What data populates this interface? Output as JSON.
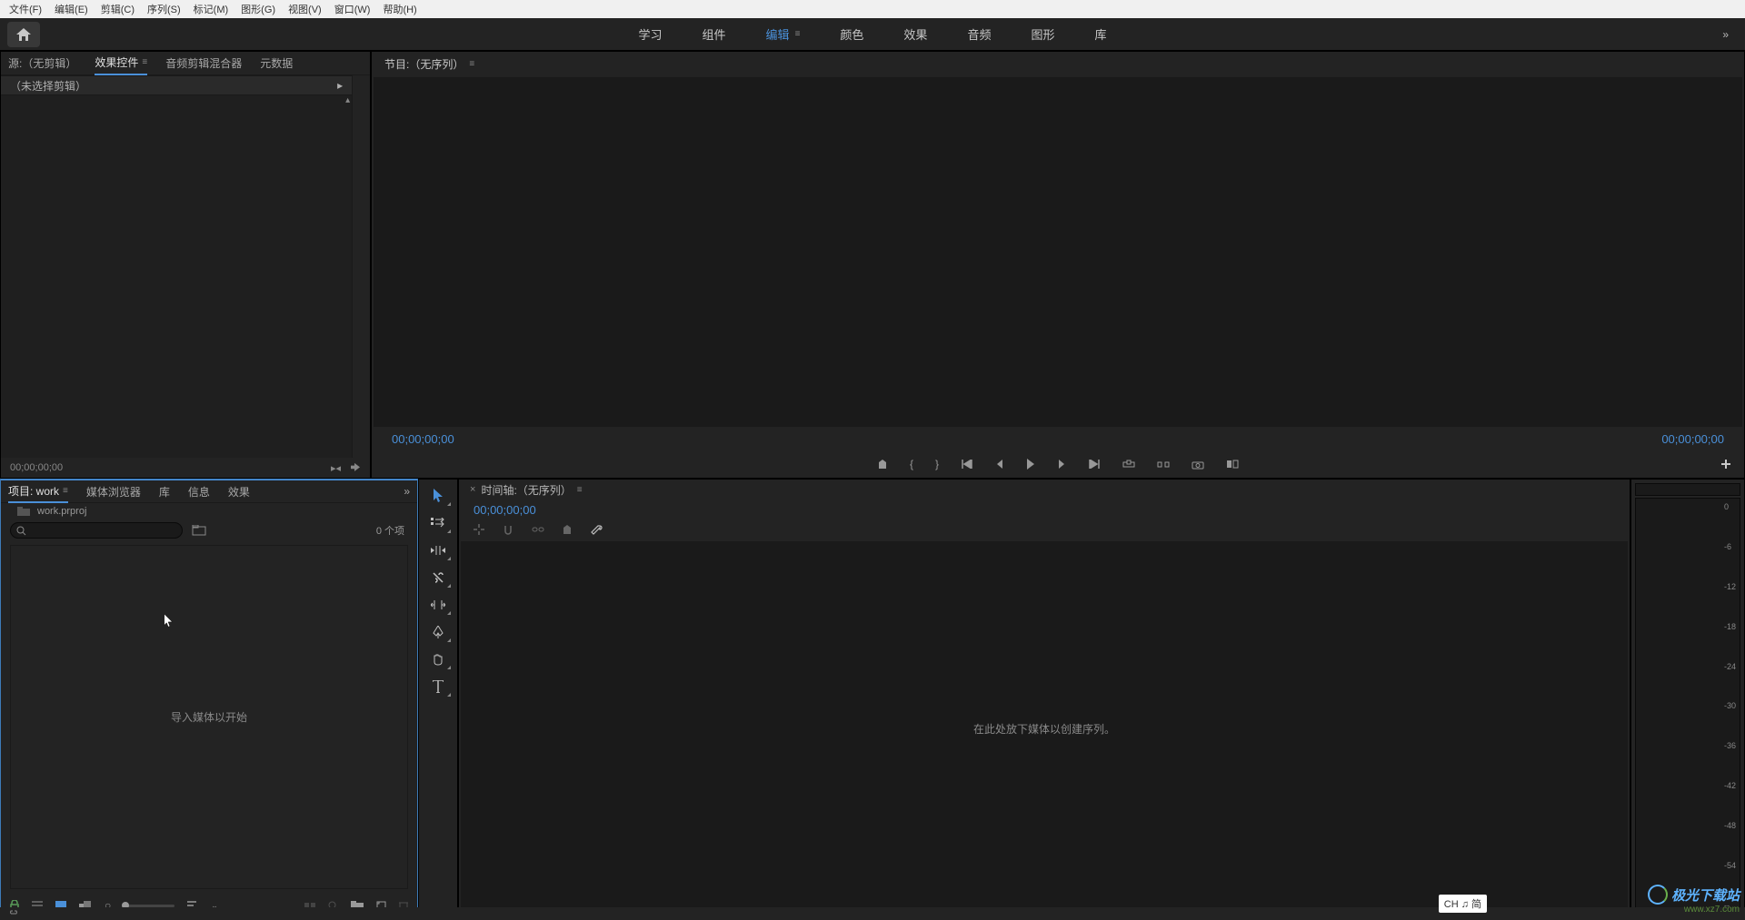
{
  "menu": {
    "file": "文件(F)",
    "edit": "编辑(E)",
    "clip": "剪辑(C)",
    "sequence": "序列(S)",
    "marker": "标记(M)",
    "graphics": "图形(G)",
    "view": "视图(V)",
    "window": "窗口(W)",
    "help": "帮助(H)"
  },
  "workspace": {
    "tabs": {
      "learn": "学习",
      "assembly": "组件",
      "edit": "编辑",
      "color": "颜色",
      "effects": "效果",
      "audio": "音频",
      "graphics": "图形",
      "library": "库"
    }
  },
  "effect_controls": {
    "tabs": {
      "source": "源:（无剪辑）",
      "effect_ctrl": "效果控件",
      "audio_mixer": "音频剪辑混合器",
      "metadata": "元数据"
    },
    "no_clip": "（未选择剪辑）",
    "timecode": "00;00;00;00"
  },
  "program": {
    "title": "节目:（无序列）",
    "tc_left": "00;00;00;00",
    "tc_right": "00;00;00;00"
  },
  "project": {
    "tabs": {
      "project": "项目: work",
      "media_browser": "媒体浏览器",
      "libraries": "库",
      "info": "信息",
      "effects": "效果"
    },
    "filename": "work.prproj",
    "item_count": "0 个项",
    "empty_message": "导入媒体以开始"
  },
  "timeline": {
    "title": "时间轴:（无序列）",
    "timecode": "00;00;00;00",
    "empty_message": "在此处放下媒体以创建序列。"
  },
  "audio_meter": {
    "ticks": [
      "0",
      "-6",
      "-12",
      "-18",
      "-24",
      "-30",
      "-36",
      "-42",
      "-48",
      "-54",
      "--"
    ]
  },
  "ime": {
    "label": "CH ♫ 简"
  },
  "watermark": {
    "name": "极光下载站",
    "url": "www.xz7.com"
  }
}
